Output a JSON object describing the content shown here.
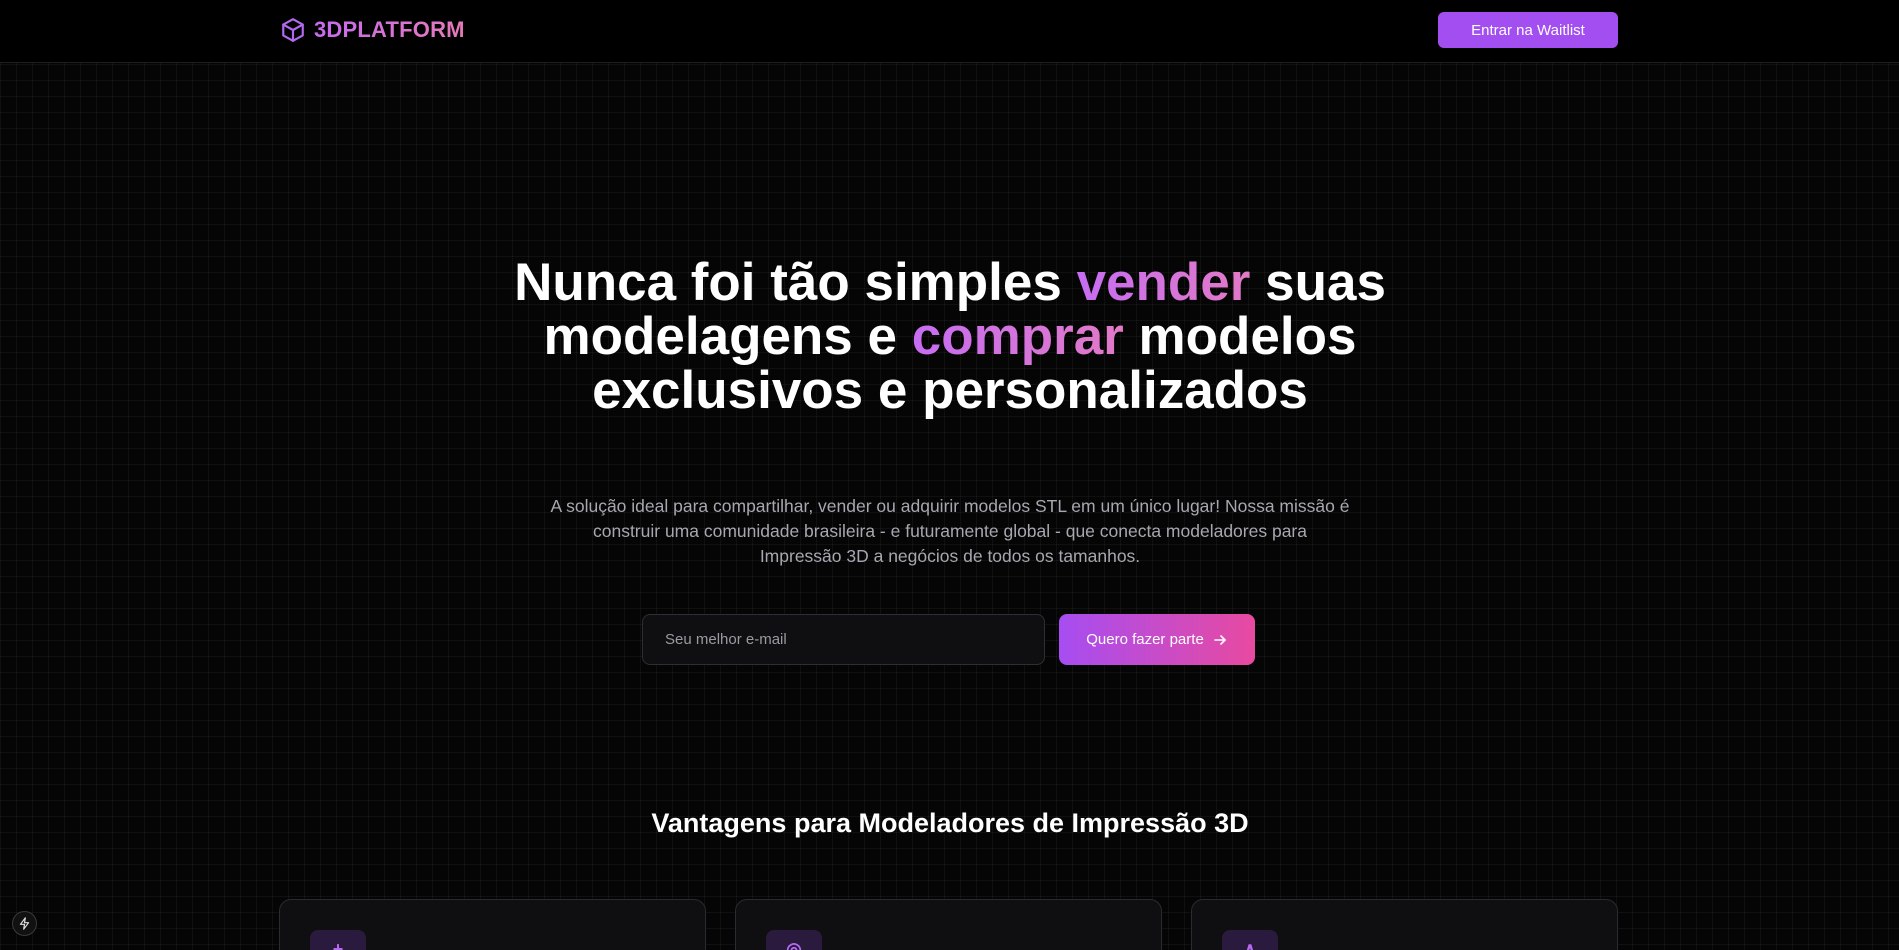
{
  "header": {
    "brand": "3DPLATFORM",
    "waitlist_label": "Entrar na Waitlist"
  },
  "hero": {
    "title_part1": "Nunca foi tão simples ",
    "title_accent1": "vender",
    "title_part2": " suas modelagens e ",
    "title_accent2": "comprar",
    "title_part3": " modelos exclusivos e personalizados",
    "subtitle": "A solução ideal para compartilhar, vender ou adquirir modelos STL em um único lugar! Nossa missão é construir uma comunidade brasileira - e futuramente global - que conecta modeladores para Impressão 3D a negócios de todos os tamanhos.",
    "email_placeholder": "Seu melhor e-mail",
    "cta_label": "Quero fazer parte"
  },
  "advantages": {
    "title": "Vantagens para Modeladores de Impressão 3D",
    "cards": [
      {
        "icon": "plus-icon",
        "glyph": "+"
      },
      {
        "icon": "community-icon",
        "glyph": "◎"
      },
      {
        "icon": "chart-icon",
        "glyph": "∧"
      }
    ]
  },
  "colors": {
    "accent_purple": "#a34ef0",
    "accent_pink": "#e84aa0",
    "background": "#050505",
    "subtitle_gray": "#a7a7b0"
  }
}
